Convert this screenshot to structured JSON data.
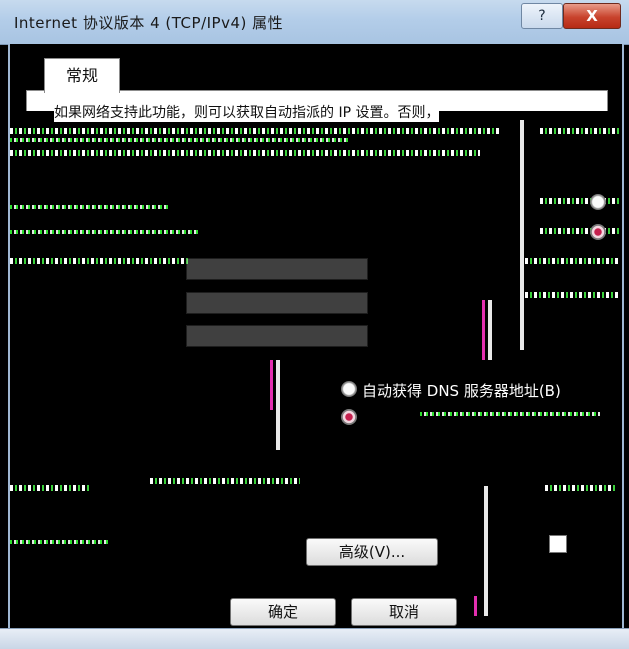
{
  "window": {
    "title": "Internet 协议版本 4 (TCP/IPv4) 属性",
    "help_label": "?",
    "close_label": "X"
  },
  "tabs": [
    {
      "label": "常规"
    }
  ],
  "general": {
    "intro_text": "如果网络支持此功能，则可以获取自动指派的 IP 设置。否则，",
    "dns_auto_label": "自动获得 DNS 服务器地址(B)"
  },
  "buttons": {
    "advanced_label": "高级(V)...",
    "ok_label": "确定",
    "cancel_label": "取消"
  },
  "colors": {
    "titlebar": "#b3cde9",
    "close": "#c8432d",
    "radio_selected": "#c5204e"
  }
}
